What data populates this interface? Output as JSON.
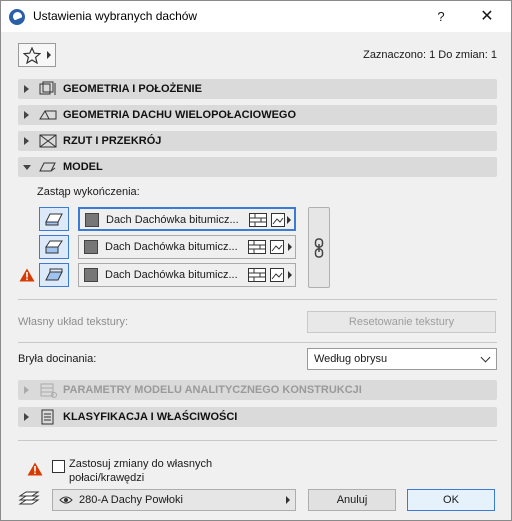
{
  "window": {
    "title": "Ustawienia wybranych dachów",
    "help_label": "?",
    "close_label": "✕"
  },
  "header": {
    "favorites_icon": "star-icon",
    "selection_info": "Zaznaczono: 1 Do zmian: 1"
  },
  "sections": {
    "geometry": "GEOMETRIA I POŁOŻENIE",
    "roof_geometry": "GEOMETRIA DACHU WIELOPOŁACIOWEGO",
    "plan_section": "RZUT I PRZEKRÓJ",
    "model": "MODEL",
    "analytical": "PARAMETRY MODELU ANALITYCZNEGO KONSTRUKCJI",
    "classification": "KLASYFIKACJA I WŁAŚCIWOŚCI"
  },
  "model": {
    "override_label": "Zastąp wykończenia:",
    "surfaces": [
      {
        "name": "Dach Dachówka bitumicz...",
        "swatch_color": "#787878"
      },
      {
        "name": "Dach Dachówka bitumicz...",
        "swatch_color": "#787878"
      },
      {
        "name": "Dach Dachówka bitumicz...",
        "swatch_color": "#787878"
      }
    ],
    "texture_label": "Własny układ tekstury:",
    "reset_texture_label": "Resetowanie tekstury",
    "trim_body_label": "Bryła docinania:",
    "trim_body_value": "Według obrysu"
  },
  "footer": {
    "apply_label_line1": "Zastosuj zmiany do własnych",
    "apply_label_line2": "połaci/krawędzi",
    "layer_value": "280-A Dachy Powłoki",
    "cancel_label": "Anuluj",
    "ok_label": "OK"
  },
  "colors": {
    "accent": "#3a7bd5",
    "warning": "#d83b01",
    "section_bg": "#dadada"
  }
}
